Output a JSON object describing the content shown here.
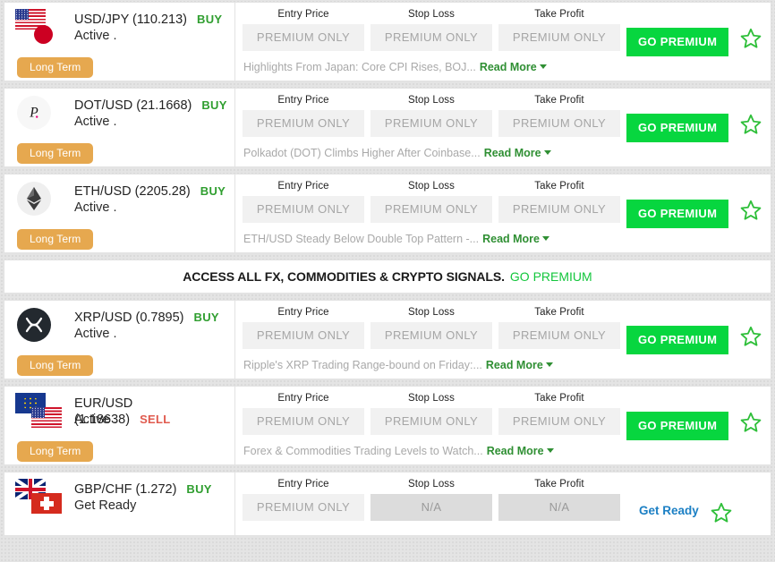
{
  "columns": {
    "entry": "Entry Price",
    "stop": "Stop Loss",
    "take": "Take Profit"
  },
  "labels": {
    "premium_only": "PREMIUM ONLY",
    "na": "N/A",
    "go_premium": "GO PREMIUM",
    "get_ready": "Get Ready",
    "read_more": "Read More",
    "long_term": "Long Term",
    "buy": "BUY",
    "sell": "SELL",
    "favorite_icon": "star-outline-icon"
  },
  "colors": {
    "buy": "#2f9e2f",
    "sell": "#e05a4e",
    "cta_green": "#07d63f",
    "tag_orange": "#e6a84f",
    "link_blue": "#1b7fc4",
    "read_more_green": "#2f8f33",
    "muted_text": "#a6a6a6",
    "page_bg": "#e4e4e4"
  },
  "promo": {
    "text": "ACCESS ALL FX, COMMODITIES & CRYPTO SIGNALS.",
    "cta": "GO PREMIUM"
  },
  "signals": [
    {
      "pair": "USD/JPY (110.213)",
      "direction": "BUY",
      "direction_kind": "buy",
      "status": "Active .",
      "tag": "Long Term",
      "icon": "flag-pair-us-jp",
      "entry": "PREMIUM ONLY",
      "stop": "PREMIUM ONLY",
      "take": "PREMIUM ONLY",
      "action": "GO PREMIUM",
      "action_kind": "button",
      "news": "Highlights From Japan: Core CPI Rises, BOJ...",
      "read_more": "Read More"
    },
    {
      "pair": "DOT/USD (21.1668)",
      "direction": "BUY",
      "direction_kind": "buy",
      "status": "Active .",
      "tag": "Long Term",
      "icon": "coin-polkadot-icon",
      "entry": "PREMIUM ONLY",
      "stop": "PREMIUM ONLY",
      "take": "PREMIUM ONLY",
      "action": "GO PREMIUM",
      "action_kind": "button",
      "news": "Polkadot (DOT) Climbs Higher After Coinbase...",
      "read_more": "Read More"
    },
    {
      "pair": "ETH/USD (2205.28)",
      "direction": "BUY",
      "direction_kind": "buy",
      "status": "Active .",
      "tag": "Long Term",
      "icon": "coin-ethereum-icon",
      "entry": "PREMIUM ONLY",
      "stop": "PREMIUM ONLY",
      "take": "PREMIUM ONLY",
      "action": "GO PREMIUM",
      "action_kind": "button",
      "news": "ETH/USD Steady Below Double Top Pattern -...",
      "read_more": "Read More"
    },
    {
      "pair": "XRP/USD (0.7895)",
      "direction": "BUY",
      "direction_kind": "buy",
      "status": "Active .",
      "tag": "Long Term",
      "icon": "coin-ripple-icon",
      "entry": "PREMIUM ONLY",
      "stop": "PREMIUM ONLY",
      "take": "PREMIUM ONLY",
      "action": "GO PREMIUM",
      "action_kind": "button",
      "news": "Ripple's XRP Trading Range-bound on Friday:...",
      "read_more": "Read More"
    },
    {
      "pair": "EUR/USD (1.18638)",
      "direction": "SELL",
      "direction_kind": "sell",
      "status": "Active .",
      "tag": "Long Term",
      "icon": "flag-pair-eu-us",
      "entry": "PREMIUM ONLY",
      "stop": "PREMIUM ONLY",
      "take": "PREMIUM ONLY",
      "action": "GO PREMIUM",
      "action_kind": "button",
      "news": "Forex & Commodities Trading Levels to Watch...",
      "read_more": "Read More"
    },
    {
      "pair": "GBP/CHF (1.272)",
      "direction": "BUY",
      "direction_kind": "buy",
      "status": "Get Ready",
      "tag": null,
      "icon": "flag-pair-uk-ch",
      "entry": "PREMIUM ONLY",
      "stop": "N/A",
      "take": "N/A",
      "action": "Get Ready",
      "action_kind": "link",
      "news": null,
      "read_more": null
    }
  ]
}
